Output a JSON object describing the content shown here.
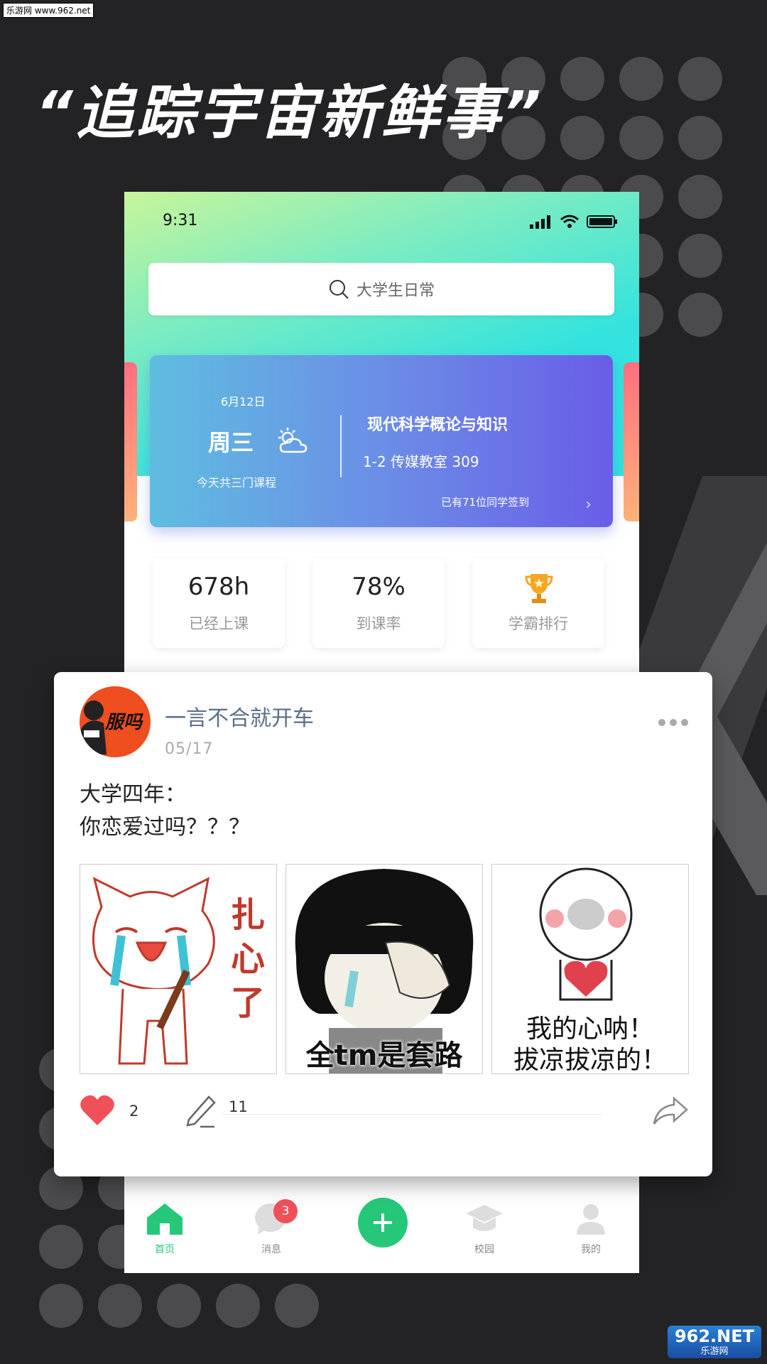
{
  "watermark": "乐游网 www.962.net",
  "headline": "“追踪宇宙新鲜事”",
  "status_bar": {
    "time": "9:31"
  },
  "search": {
    "placeholder": "大学生日常"
  },
  "course_card": {
    "date": "6月12日",
    "weekday": "周三",
    "summary": "今天共三门课程",
    "course_name": "现代科学概论与知识",
    "course_info": "1-2  传媒教室 309",
    "checkin_text": "已有71位同学签到"
  },
  "stats": [
    {
      "value": "678h",
      "label": "已经上课"
    },
    {
      "value": "78%",
      "label": "到课率"
    },
    {
      "value": "",
      "label": "学霸排行",
      "icon": "trophy-icon"
    }
  ],
  "post": {
    "avatar_text": "服吗",
    "username": "一言不合就开车",
    "date": "05/17",
    "text_line1": "大学四年：",
    "text_line2": "你恋爱过吗？？？",
    "images": [
      {
        "caption": "扎心了",
        "icon": "crying-cat-meme"
      },
      {
        "caption": "全tm是套路",
        "icon": "crying-girl-meme"
      },
      {
        "caption_line1": "我的心呐！",
        "caption_line2": "拔凉拔凉的！",
        "icon": "heartbroken-meme"
      }
    ],
    "likes": "2",
    "comments": "11"
  },
  "tabbar": {
    "items": [
      {
        "label": "首页",
        "icon": "home-icon",
        "active": true
      },
      {
        "label": "消息",
        "icon": "message-icon",
        "badge": "3"
      },
      {
        "label": "",
        "icon": "plus-icon"
      },
      {
        "label": "校园",
        "icon": "campus-icon"
      },
      {
        "label": "我的",
        "icon": "user-icon"
      }
    ]
  },
  "site_logo": {
    "main": "962.NET",
    "sub": "乐游网"
  },
  "colors": {
    "accent_green": "#27c77a",
    "badge_red": "#f0505a",
    "heart_red": "#f0505a",
    "username_blue": "#5b6f88"
  }
}
